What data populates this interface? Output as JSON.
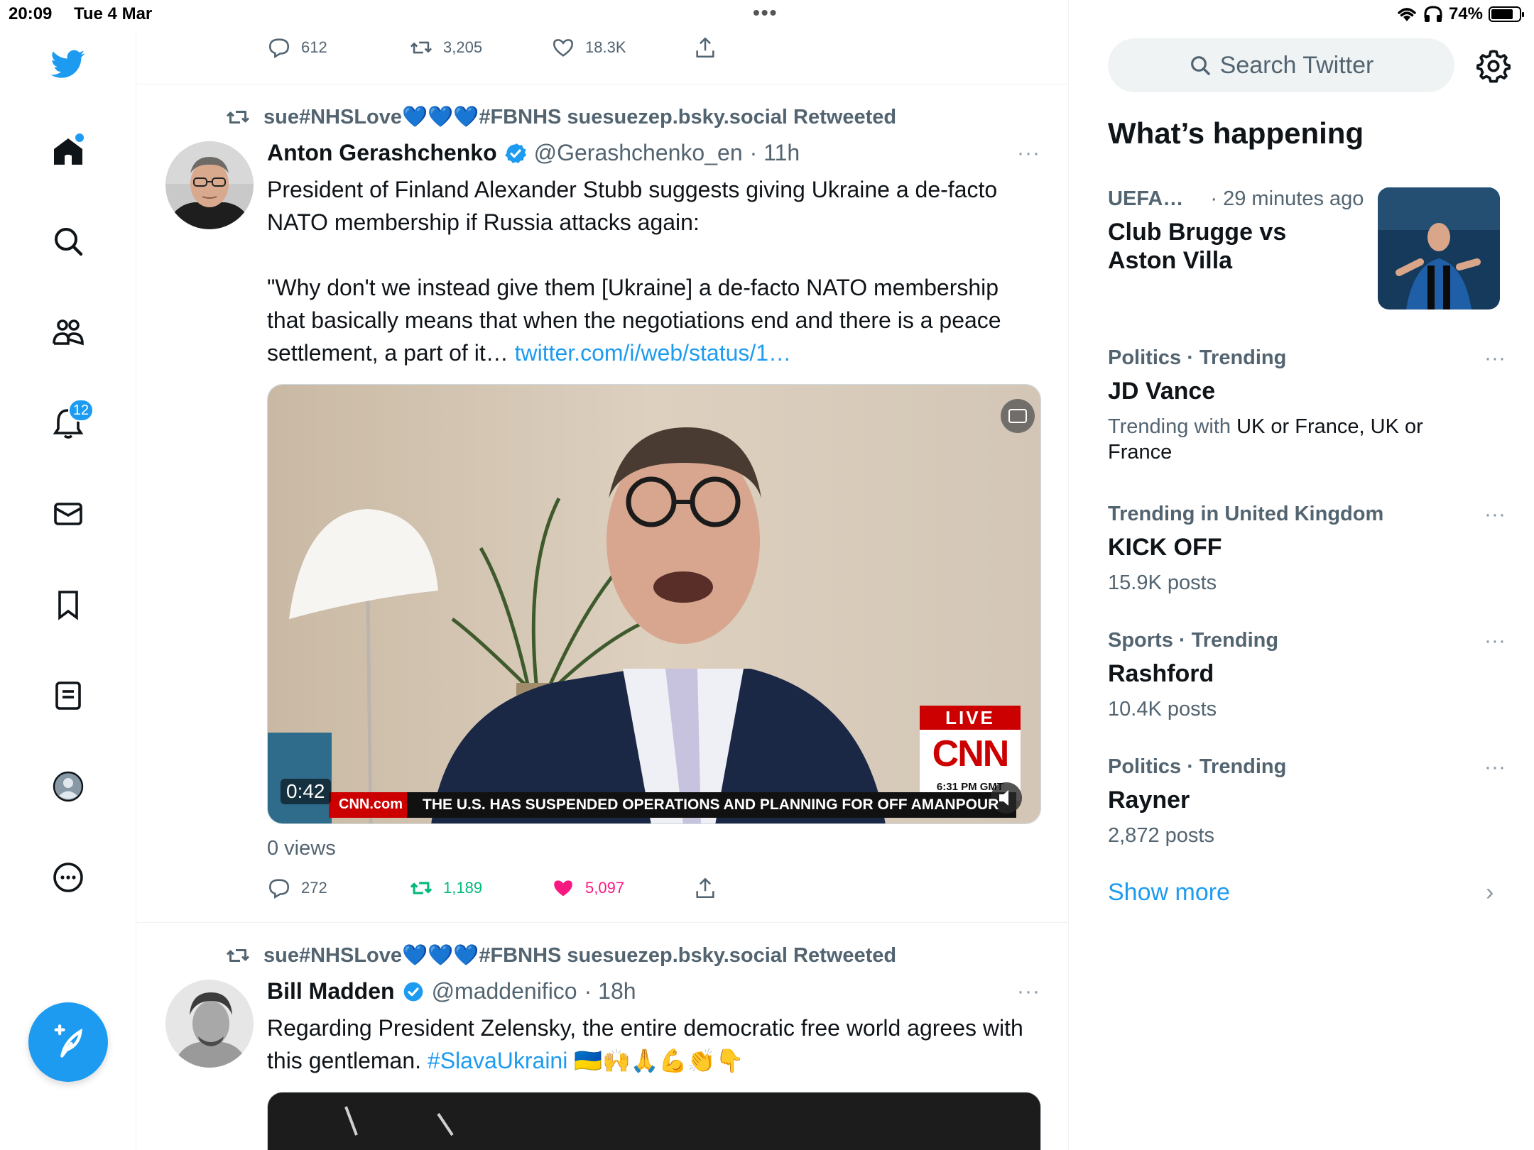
{
  "status_bar": {
    "time": "20:09",
    "date": "Tue 4 Mar",
    "battery": "74%",
    "battery_level": 0.74,
    "dots": "•••"
  },
  "nav": {
    "notifications_count": "12"
  },
  "top_tweet_actions": {
    "replies": "612",
    "retweets": "3,205",
    "likes": "18.3K"
  },
  "tweets": [
    {
      "retweeted_by": "sue#NHSLove💙💙💙#FBNHS suesuezep.bsky.social Retweeted",
      "name": "Anton Gerashchenko",
      "handle": "@Gerashchenko_en",
      "time": "· 11h",
      "text_1": "President of Finland Alexander Stubb suggests giving Ukraine a de-facto NATO membership if Russia attacks again:",
      "text_2": "\"Why don't we instead give them [Ukraine] a de-facto NATO membership that basically means that when the negotiations end and there is a peace settlement, a part of it… ",
      "link": "twitter.com/i/web/status/1…",
      "video": {
        "duration": "0:42",
        "live_label": "LIVE",
        "cnn_logo": "CNN",
        "cnn_time": "6:31 PM GMT",
        "ticker_source": "CNN.com",
        "ticker_text": "THE U.S. HAS SUSPENDED OPERATIONS AND PLANNING FOR OFF",
        "ticker_show": "AMANPOUR"
      },
      "views": "0 views",
      "replies": "272",
      "retweets": "1,189",
      "likes": "5,097"
    },
    {
      "retweeted_by": "sue#NHSLove💙💙💙#FBNHS suesuezep.bsky.social Retweeted",
      "name": "Bill Madden",
      "handle": "@maddenifico",
      "time": "· 18h",
      "text_1": "Regarding President Zelensky, the entire democratic free world agrees with this gentleman. ",
      "hashtag": "#SlavaUkraini",
      "emojis": " 🇺🇦🙌🙏💪👏👇"
    }
  ],
  "sidebar": {
    "search_placeholder": "Search Twitter",
    "title": "What’s happening",
    "trends": [
      {
        "category": "UEFA…",
        "time": "· 29 minutes ago",
        "topic": "Club Brugge vs Aston Villa"
      },
      {
        "category": "Politics · Trending",
        "topic": "JD Vance",
        "sub_prefix": "Trending with ",
        "sub_highlight": "UK or France, UK or France"
      },
      {
        "category": "Trending in United Kingdom",
        "topic": "KICK OFF",
        "sub": "15.9K posts"
      },
      {
        "category": "Sports · Trending",
        "topic": "Rashford",
        "sub": "10.4K posts"
      },
      {
        "category": "Politics · Trending",
        "topic": "Rayner",
        "sub": "2,872 posts"
      }
    ],
    "show_more": "Show more",
    "trend_dots": "···"
  },
  "colors": {
    "accent": "#1d9bf0",
    "retweet_green": "#00ba7c",
    "like_pink": "#f91880",
    "muted": "#536471"
  }
}
